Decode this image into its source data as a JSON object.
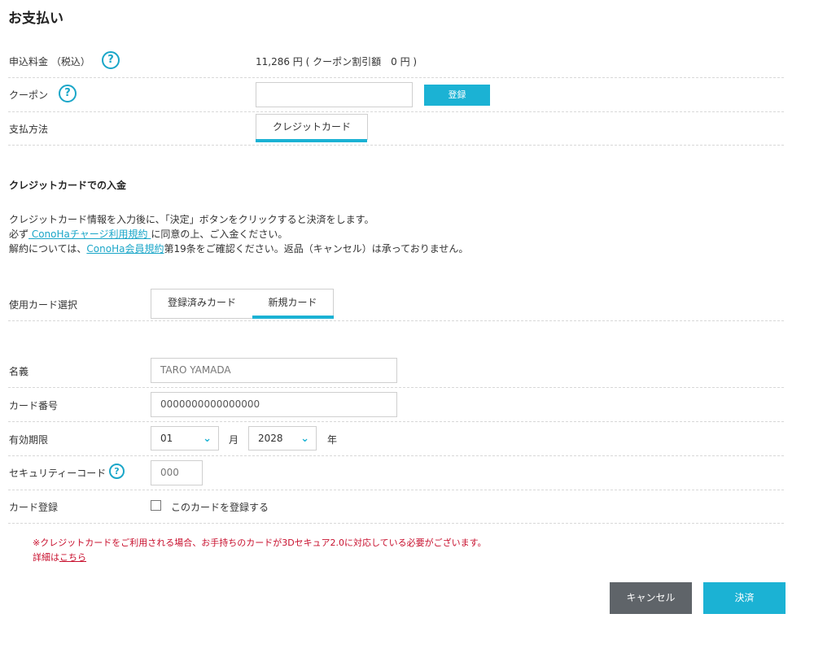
{
  "page_title": "お支払い",
  "summary": {
    "amount_label": "申込料金 （税込）",
    "amount_value": "11,286 円 ( クーポン割引額　0 円 )",
    "coupon_label": "クーポン",
    "coupon_input_value": "",
    "coupon_button": "登録",
    "payment_method_label": "支払方法",
    "payment_method_tab": "クレジットカード"
  },
  "credit_section": {
    "heading": "クレジットカードでの入金",
    "line1": "クレジットカード情報を入力後に、「決定」ボタンをクリックすると決済をします。",
    "line2_prefix": "必ず",
    "line2_link": " ConoHaチャージ利用規約 ",
    "line2_suffix": "に同意の上、ご入金ください。",
    "line3_prefix": "解約については、",
    "line3_link": "ConoHa会員規約",
    "line3_suffix": "第19条をご確認ください。返品（キャンセル）は承っておりません。"
  },
  "card_select": {
    "label": "使用カード選択",
    "tabs": [
      "登録済みカード",
      "新規カード"
    ],
    "active_tab": "新規カード"
  },
  "form": {
    "name_label": "名義",
    "name_placeholder": "TARO YAMADA",
    "card_number_label": "カード番号",
    "card_number_placeholder": "0000000000000000",
    "expiry_label": "有効期限",
    "expiry_month": "01",
    "month_unit": "月",
    "expiry_year": "2028",
    "year_unit": "年",
    "security_label": "セキュリティーコード",
    "security_placeholder": "000",
    "register_label": "カード登録",
    "register_checkbox_label": "このカードを登録する"
  },
  "notice": {
    "line1": "※クレジットカードをご利用される場合、お手持ちのカードが3Dセキュア2.0に対応している必要がございます。",
    "line2_prefix": "詳細は",
    "line2_link": "こちら"
  },
  "actions": {
    "cancel": "キャンセル",
    "submit": "決済"
  },
  "colors": {
    "accent": "#1bb2d4",
    "cancel_bg": "#5f6469",
    "notice": "#c8102e"
  },
  "icons": [
    "help-icon",
    "chevron-down-icon",
    "checkbox-icon"
  ]
}
